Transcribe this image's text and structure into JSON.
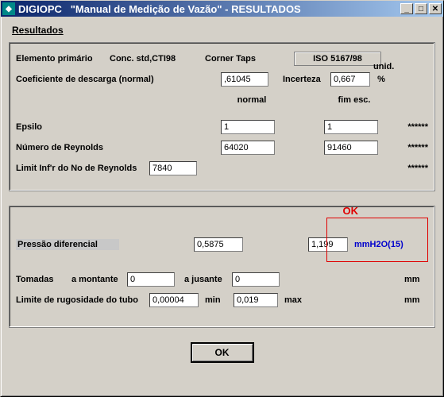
{
  "titlebar": {
    "app": "DIGIOPC",
    "doc": "\"Manual de Medição de Vazão\"",
    "suffix": "- RESULTADOS"
  },
  "section_title": "Resultados",
  "group1": {
    "elemento_label": "Elemento primário",
    "elemento_value": "Conc. std,CTI98",
    "corner_taps": "Corner Taps",
    "iso": "ISO 5167/98",
    "unid": "unid.",
    "coef_label": "Coeficiente de descarga (normal)",
    "coef_value": ",61045",
    "incerteza_label": "Incerteza",
    "incerteza_value": "0,667",
    "incerteza_unit": "%",
    "normal": "normal",
    "fim_esc": "fim esc.",
    "epsilo_label": "Epsilo",
    "epsilo_norm": "1",
    "epsilo_fim": "1",
    "reynolds_label": "Número de Reynolds",
    "reynolds_norm": "64020",
    "reynolds_fim": "91460",
    "limit_label": "Limit Inf'r do No de Reynolds",
    "limit_value": "7840",
    "stars": "******"
  },
  "group2": {
    "ok_annot": "OK",
    "pdiff_label": "Pressão diferencial",
    "pdiff_norm": "0,5875",
    "pdiff_fim": "1,199",
    "pdiff_unit": "mmH2O(15)",
    "tomadas_label": "Tomadas",
    "montante_label": "a montante",
    "montante_value": "0",
    "jusante_label": "a jusante",
    "jusante_value": "0",
    "tomadas_unit": "mm",
    "rugos_label": "Limite de rugosidade do tubo",
    "rugos_min": "0,00004",
    "min_label": "min",
    "rugos_max": "0,019",
    "max_label": "max",
    "rugos_unit": "mm"
  },
  "buttons": {
    "ok": "OK"
  }
}
